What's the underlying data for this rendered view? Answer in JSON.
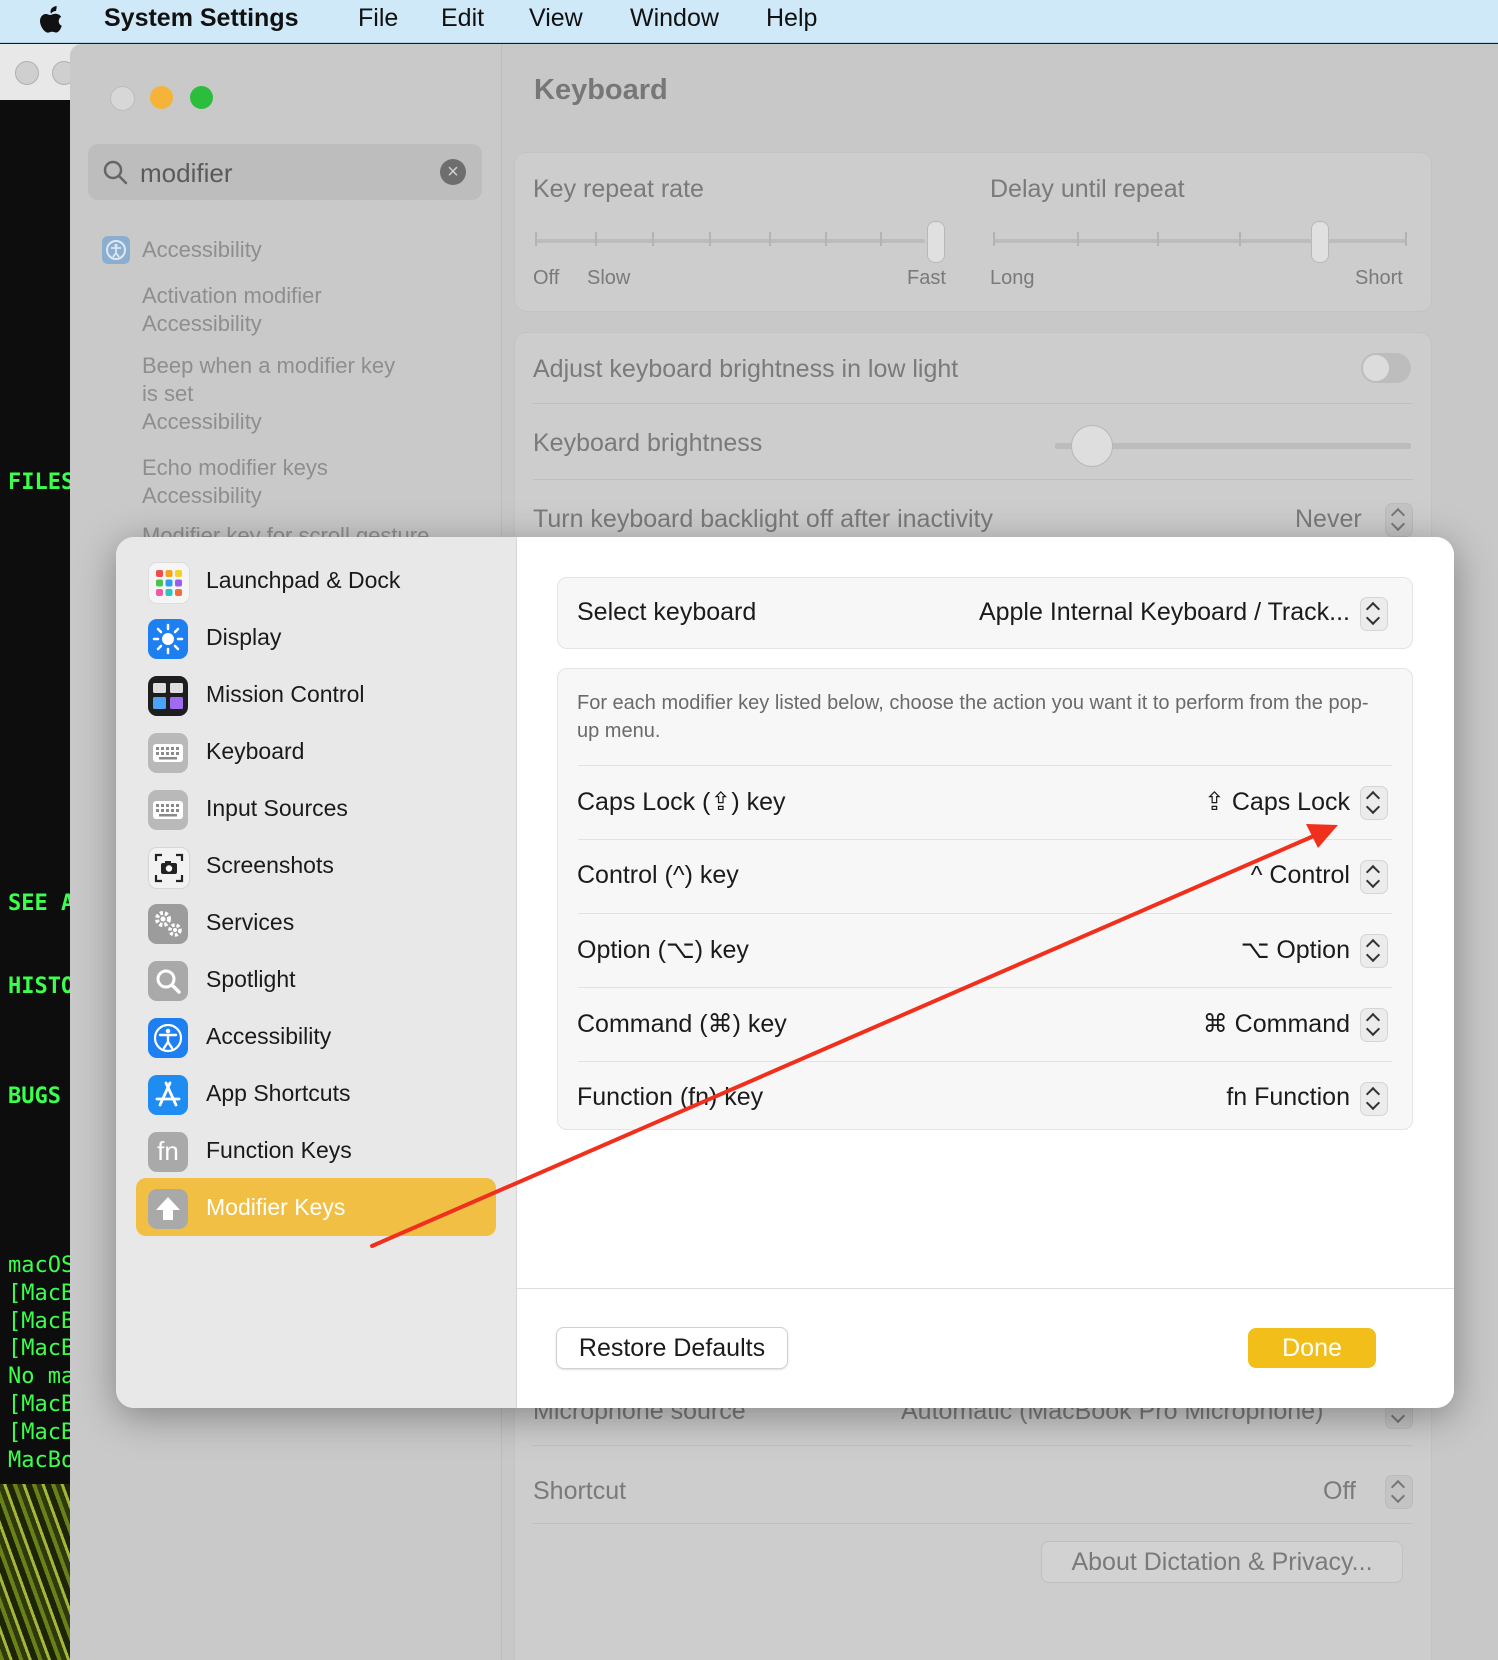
{
  "menubar": {
    "app_name": "System Settings",
    "items": [
      "File",
      "Edit",
      "View",
      "Window",
      "Help"
    ]
  },
  "terminal": {
    "lines": [
      "FILES",
      "SEE A",
      "HISTO",
      "BUGS",
      "macOS",
      "[MacBo",
      "[MacBo",
      "[MacBo",
      "No ma",
      "[MacBo",
      "[MacBo",
      "MacBo"
    ]
  },
  "settings_window": {
    "search": {
      "value": "modifier"
    },
    "results": [
      {
        "title": "Accessibility"
      },
      {
        "line1": "Activation modifier",
        "line2": "Accessibility"
      },
      {
        "line1": "Beep when a modifier key",
        "line2": "is set",
        "line3": "Accessibility"
      },
      {
        "line1": "Echo modifier keys",
        "line2": "Accessibility"
      },
      {
        "line1": "Modifier key for scroll gesture"
      }
    ],
    "title": "Keyboard",
    "key_repeat": {
      "label": "Key repeat rate",
      "min": "Off",
      "low": "Slow",
      "max": "Fast"
    },
    "delay_repeat": {
      "label": "Delay until repeat",
      "min": "Long",
      "max": "Short"
    },
    "brightness_low_light": {
      "label": "Adjust keyboard brightness in low light"
    },
    "keyboard_brightness": {
      "label": "Keyboard brightness"
    },
    "backlight_off": {
      "label": "Turn keyboard backlight off after inactivity",
      "value": "Never"
    },
    "microphone_source": {
      "label": "Microphone source",
      "value": "Automatic (MacBook Pro Microphone)"
    },
    "shortcut": {
      "label": "Shortcut",
      "value": "Off"
    },
    "about_dictation_button": "About Dictation & Privacy..."
  },
  "sheet": {
    "nav": [
      {
        "label": "Launchpad & Dock",
        "icon": "launchpad-icon"
      },
      {
        "label": "Display",
        "icon": "display-icon"
      },
      {
        "label": "Mission Control",
        "icon": "mission-control-icon"
      },
      {
        "label": "Keyboard",
        "icon": "keyboard-icon"
      },
      {
        "label": "Input Sources",
        "icon": "input-sources-icon"
      },
      {
        "label": "Screenshots",
        "icon": "screenshots-icon"
      },
      {
        "label": "Services",
        "icon": "services-icon"
      },
      {
        "label": "Spotlight",
        "icon": "spotlight-icon"
      },
      {
        "label": "Accessibility",
        "icon": "accessibility-icon"
      },
      {
        "label": "App Shortcuts",
        "icon": "app-shortcuts-icon"
      },
      {
        "label": "Function Keys",
        "icon": "function-keys-icon"
      },
      {
        "label": "Modifier Keys",
        "icon": "modifier-keys-icon",
        "selected": true
      }
    ],
    "select_keyboard": {
      "label": "Select keyboard",
      "value": "Apple Internal Keyboard / Track..."
    },
    "description": "For each modifier key listed below, choose the action you want it to perform from the pop-up menu.",
    "modifiers": [
      {
        "label": "Caps Lock (⇪) key",
        "value": "⇪ Caps Lock"
      },
      {
        "label": "Control (^) key",
        "value": "^ Control"
      },
      {
        "label": "Option (⌥) key",
        "value": "⌥ Option"
      },
      {
        "label": "Command (⌘) key",
        "value": "⌘ Command"
      },
      {
        "label": "Function (fn) key",
        "value": "fn Function"
      }
    ],
    "restore_defaults": "Restore Defaults",
    "done": "Done"
  },
  "colors": {
    "accent": "#f2bf1a",
    "selection": "#f0bf44",
    "annotation_arrow": "#f0301c",
    "terminal_text": "#3bff4c"
  }
}
